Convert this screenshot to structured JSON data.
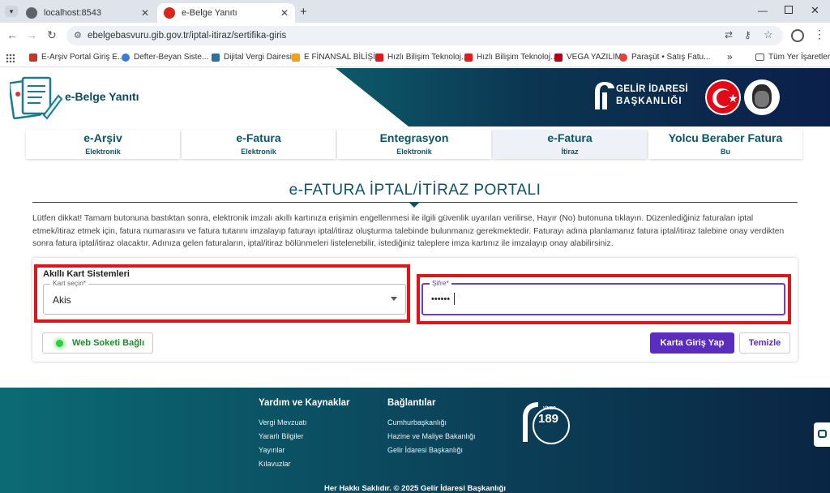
{
  "browser": {
    "tabs": [
      {
        "title": "localhost:8543"
      },
      {
        "title": "e-Belge Yanıtı"
      }
    ],
    "new_tab": "+",
    "url": "ebelgebasvuru.gib.gov.tr/iptal-itiraz/sertifika-giris",
    "bookmarks": [
      "E-Arşiv Portal Giriş E...",
      "Defter-Beyan Siste...",
      "Dijital Vergi Dairesi",
      "E FİNANSAL BİLİŞİM",
      "Hızlı Bilişim Teknoloj...",
      "Hızlı Bilişim Teknoloj...",
      "VEGA YAZILIM",
      "Paraşüt • Satış Fatu..."
    ],
    "bookmarks_more": "»",
    "all_bookmarks": "Tüm Yer İşaretleri"
  },
  "header": {
    "app_title": "e-Belge Yanıtı",
    "gib_line1": "GELİR İDARESİ",
    "gib_line2": "BAŞKANLIĞI"
  },
  "nav": [
    {
      "title": "e-Arşiv",
      "sub": "Elektronik"
    },
    {
      "title": "e-Fatura",
      "sub": "Elektronik"
    },
    {
      "title": "Entegrasyon",
      "sub": "Elektronik"
    },
    {
      "title": "e-Fatura",
      "sub": "İtiraz"
    },
    {
      "title": "Yolcu Beraber Fatura",
      "sub": "Bu"
    }
  ],
  "page": {
    "title": "e-FATURA İPTAL/İTİRAZ PORTALI",
    "notice": "Lütfen dikkat! Tamam butonuna bastıktan sonra, elektronik imzalı akıllı kartınıza erişimin engellenmesi ile ilgili güvenlik uyarıları verilirse, Hayır (No) butonuna tıklayın. Düzenlediğiniz faturaları iptal etmek/itiraz etmek için, fatura numarasını ve fatura tutarını imzalayıp faturayı iptal/itiraz oluşturma talebinde bulunmanız gerekmektedir. Faturayı adına planlamanız fatura iptal/itiraz talebine onay verdikten sonra fatura iptal/itiraz olacaktır. Adınıza gelen faturaların, iptal/itiraz bölünmeleri listelenebilir, istediğiniz taleplere imza kartınız ile imzalayıp onay alabilirsiniz."
  },
  "form": {
    "section_title": "Akıllı Kart Sistemleri",
    "card_label": "Kart seçin*",
    "card_value": "Akis",
    "pin_label": "Şifre*",
    "pin_value": "••••••",
    "websocket_label": "Web Soketi Bağlı",
    "login_label": "Karta Giriş Yap",
    "clear_label": "Temizle"
  },
  "footer": {
    "col1_title": "Yardım ve Kaynaklar",
    "col1": [
      "Vergi Mevzuatı",
      "Yararlı Bilgiler",
      "Yayınlar",
      "Kılavuzlar"
    ],
    "col2_title": "Bağlantılar",
    "col2": [
      "Cumhurbaşkanlığı",
      "Hazine ve Maliye Bakanlığı",
      "Gelir İdaresi Başkanlığı"
    ],
    "vimer_top": "VİMER",
    "vimer_num": "189",
    "copyright": "Her Hakkı Saklıdır. © 2025 Gelir İdaresi Başkanlığı"
  },
  "colors": {
    "accent": "#0b5567",
    "highlight": "#e0141b",
    "primary_button": "#5b2dbf"
  }
}
